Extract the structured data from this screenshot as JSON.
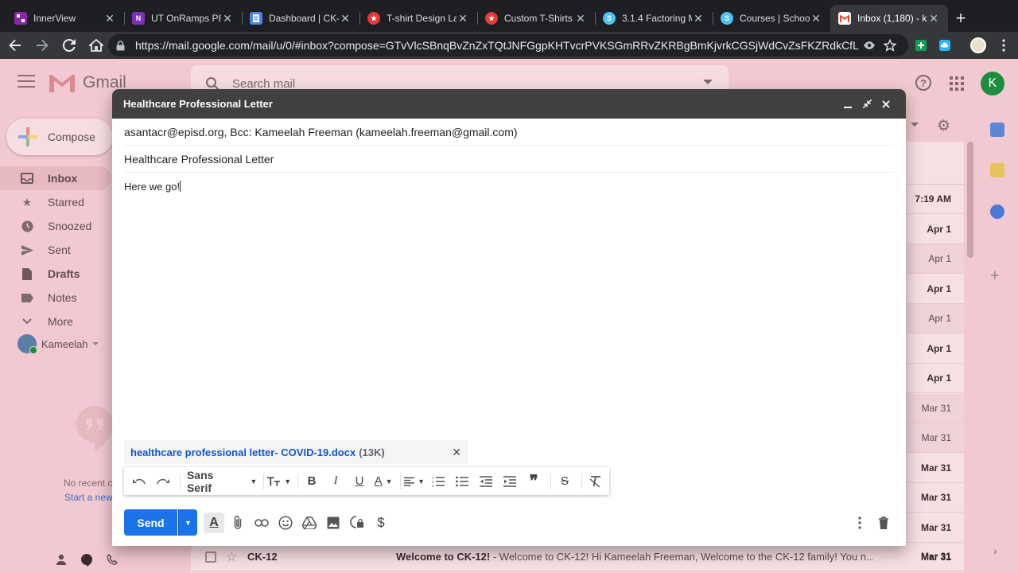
{
  "browser": {
    "tabs": [
      {
        "title": "InnerView",
        "favicon_color": "#9c27b0",
        "favicon_text": ""
      },
      {
        "title": "UT OnRamps P8",
        "favicon_color": "#7b2fbe",
        "favicon_text": "N"
      },
      {
        "title": "Dashboard | CK-",
        "favicon_color": "#4a86e8",
        "favicon_text": ""
      },
      {
        "title": "T-shirt Design La",
        "favicon_color": "#e53935",
        "favicon_text": ""
      },
      {
        "title": "Custom T-Shirts",
        "favicon_color": "#e53935",
        "favicon_text": ""
      },
      {
        "title": "3.1.4 Factoring M",
        "favicon_color": "#4fc3f7",
        "favicon_text": "S"
      },
      {
        "title": "Courses | Schoo",
        "favicon_color": "#4fc3f7",
        "favicon_text": "S"
      },
      {
        "title": "Inbox (1,180) - k",
        "favicon_color": "#ea4335",
        "favicon_text": "M"
      }
    ],
    "url": "https://mail.google.com/mail/u/0/#inbox?compose=GTvVlcSBnqBvZnZxTQtJNFGgpKHTvcrPVKSGmRRvZKRBgBmKjvrkCGSjWdCvZsFKZRdkCfLh..."
  },
  "gmail": {
    "logo_text": "Gmail",
    "search_placeholder": "Search mail",
    "avatar_letter": "K",
    "compose_label": "Compose",
    "nav": [
      {
        "label": "Inbox",
        "icon": "inbox-icon",
        "bold": true
      },
      {
        "label": "Starred",
        "icon": "star-icon",
        "bold": false
      },
      {
        "label": "Snoozed",
        "icon": "clock-icon",
        "bold": false
      },
      {
        "label": "Sent",
        "icon": "send-icon",
        "bold": false
      },
      {
        "label": "Drafts",
        "icon": "draft-icon",
        "bold": true
      },
      {
        "label": "Notes",
        "icon": "label-icon",
        "bold": false
      },
      {
        "label": "More",
        "icon": "chevron-down-icon",
        "bold": false
      }
    ],
    "hangouts_user": "Kameelah",
    "hangouts_empty": "No recent c",
    "hangouts_link": "Start a new",
    "dates": [
      "7:19 AM",
      "Apr 1",
      "Apr 1",
      "Apr 1",
      "Apr 1",
      "Apr 1",
      "Apr 1",
      "Mar 31",
      "Mar 31",
      "Mar 31",
      "Mar 31",
      "Mar 31",
      "Mar 31"
    ],
    "last_row": {
      "sender": "CK-12",
      "subject": "Welcome to CK-12!",
      "snippet": " - Welcome to CK-12! Hi Kameelah Freeman, Welcome to the CK-12 family! You n...",
      "date": "Mar 31"
    }
  },
  "compose": {
    "title": "Healthcare Professional Letter",
    "recipients": "asantacr@episd.org, Bcc: Kameelah Freeman (kameelah.freeman@gmail.com)",
    "subject": "Healthcare Professional Letter",
    "body": "Here we go!",
    "attachment": {
      "name": "healthcare professional letter- COVID-19.docx",
      "size": "(13K)"
    },
    "font": "Sans Serif",
    "send_label": "Send"
  }
}
